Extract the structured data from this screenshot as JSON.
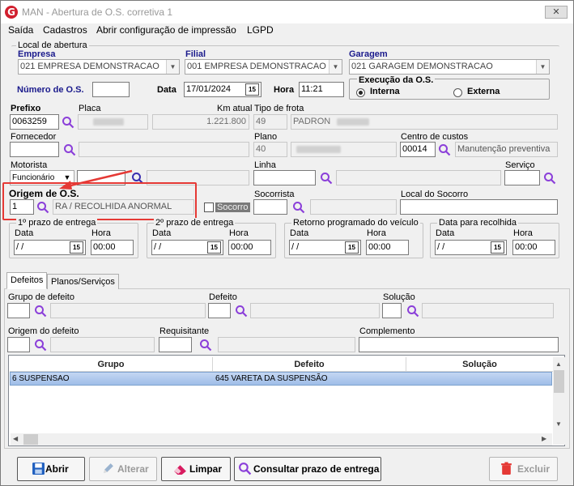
{
  "window": {
    "title": "MAN - Abertura de O.S. corretiva 1",
    "close": "✕"
  },
  "menu": [
    "Saída",
    "Cadastros",
    "Abrir configuração de impressão",
    "LGPD"
  ],
  "local": {
    "group_title": "Local de abertura",
    "empresa_label": "Empresa",
    "empresa_value": "021 EMPRESA DEMONSTRACAO",
    "filial_label": "Filial",
    "filial_value": "001 EMPRESA DEMONSTRACAO",
    "garagem_label": "Garagem",
    "garagem_value": "021 GARAGEM DEMONSTRACAO"
  },
  "os": {
    "numero_label": "Número de O.S.",
    "numero_value": "",
    "data_label": "Data",
    "data_value": "17/01/2024",
    "hora_label": "Hora",
    "hora_value": "11:21"
  },
  "execucao": {
    "title": "Execução da O.S.",
    "interna": "Interna",
    "externa": "Externa",
    "selected": "Interna"
  },
  "veiculo": {
    "prefixo_label": "Prefixo",
    "prefixo_value": "0063259",
    "placa_label": "Placa",
    "km_label": "Km atual",
    "km_value": "1.221.800",
    "tipo_label": "Tipo de frota",
    "tipo_code": "49",
    "tipo_value": "PADRON"
  },
  "fornecedor": {
    "label": "Fornecedor",
    "value": "",
    "plano_label": "Plano",
    "plano_code": "40",
    "centro_label": "Centro de custos",
    "centro_code": "00014",
    "centro_value": "Manutenção preventiva"
  },
  "motorista": {
    "label": "Motorista",
    "combo_value": "Funcionário",
    "linha_label": "Linha",
    "servico_label": "Serviço"
  },
  "origem": {
    "label": "Origem de O.S.",
    "code": "1",
    "desc": "RA / RECOLHIDA ANORMAL",
    "socorro_label": "Socorro",
    "socorrista_label": "Socorrista",
    "local_socorro_label": "Local do Socorro"
  },
  "prazos": [
    {
      "title": "1º prazo de entrega",
      "data_label": "Data",
      "data_value": " /  /",
      "hora_label": "Hora",
      "hora_value": "00:00"
    },
    {
      "title": "2º prazo de entrega",
      "data_label": "Data",
      "data_value": " /  /",
      "hora_label": "Hora",
      "hora_value": "00:00"
    },
    {
      "title": "Retorno programado do veículo",
      "data_label": "Data",
      "data_value": " /  /",
      "hora_label": "Hora",
      "hora_value": "00:00"
    },
    {
      "title": "Data para recolhida",
      "data_label": "Data",
      "data_value": " /  /",
      "hora_label": "Hora",
      "hora_value": "00:00"
    }
  ],
  "tabs": [
    "Defeitos",
    "Planos/Serviços"
  ],
  "defeitos": {
    "grupo_label": "Grupo de defeito",
    "defeito_label": "Defeito",
    "solucao_label": "Solução",
    "origem_label": "Origem do defeito",
    "requisitante_label": "Requisitante",
    "complemento_label": "Complemento"
  },
  "grid": {
    "columns": [
      "Grupo",
      "Defeito",
      "Solução"
    ],
    "rows": [
      [
        "6 SUSPENSAO",
        "645 VARETA DA SUSPENSÃO",
        ""
      ]
    ]
  },
  "buttons": {
    "abrir": "Abrir",
    "alterar": "Alterar",
    "limpar": "Limpar",
    "consultar": "Consultar prazo de entrega",
    "excluir": "Excluir"
  },
  "colors": {
    "accent": "#1a1a8c",
    "lens": "#8b3fd9",
    "highlight": "#e53935"
  }
}
